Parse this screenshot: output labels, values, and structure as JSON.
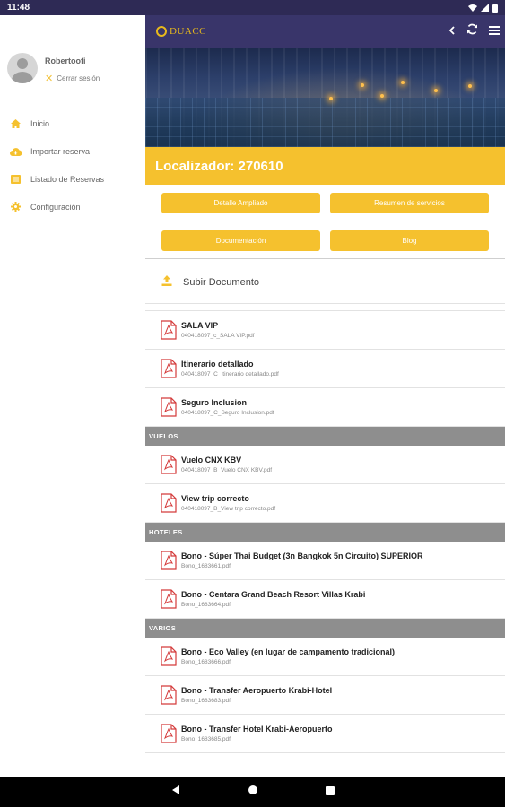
{
  "status": {
    "time": "11:48"
  },
  "user": {
    "name": "Robertoofi",
    "logout_label": "Cerrar sesión"
  },
  "menu": [
    {
      "label": "Inicio",
      "icon": "home-icon"
    },
    {
      "label": "Importar reserva",
      "icon": "cloud-upload-icon"
    },
    {
      "label": "Listado de Reservas",
      "icon": "list-icon"
    },
    {
      "label": "Configuración",
      "icon": "gear-icon"
    }
  ],
  "brand": {
    "logo_text": "DUACC",
    "accent_color": "#f5c12e",
    "appbar_color": "#39356a"
  },
  "booking": {
    "localizador": "Localizador: 270610"
  },
  "buttons": {
    "detalle": "Detalle Ampliado",
    "resumen": "Resumen de servicios",
    "documentacion": "Documentación",
    "blog": "Blog"
  },
  "upload": {
    "label": "Subir Documento"
  },
  "sections": {
    "vuelos": "VUELOS",
    "hoteles": "HOTELES",
    "varios": "VARIOS"
  },
  "documents": {
    "general": [
      {
        "title": "SALA VIP",
        "file": "040418097_c_SALA VIP.pdf"
      },
      {
        "title": "Itinerario detallado",
        "file": "040418097_C_Itinerario detallado.pdf"
      },
      {
        "title": "Seguro Inclusion",
        "file": "040418097_C_Seguro Inclusion.pdf"
      }
    ],
    "vuelos": [
      {
        "title": "Vuelo CNX KBV",
        "file": "040418097_B_Vuelo CNX KBV.pdf"
      },
      {
        "title": "View trip correcto",
        "file": "040418097_B_View trip correcto.pdf"
      }
    ],
    "hoteles": [
      {
        "title": "Bono - Súper Thai Budget (3n Bangkok 5n Circuito) SUPERIOR",
        "file": "Bono_1683661.pdf"
      },
      {
        "title": "Bono - Centara Grand Beach Resort Villas Krabi",
        "file": "Bono_1683664.pdf"
      }
    ],
    "varios": [
      {
        "title": "Bono - Eco Valley (en lugar de campamento tradicional)",
        "file": "Bono_1683666.pdf"
      },
      {
        "title": "Bono - Transfer Aeropuerto Krabi-Hotel",
        "file": "Bono_1683683.pdf"
      },
      {
        "title": "Bono - Transfer Hotel Krabi-Aeropuerto",
        "file": "Bono_1683685.pdf"
      }
    ]
  }
}
